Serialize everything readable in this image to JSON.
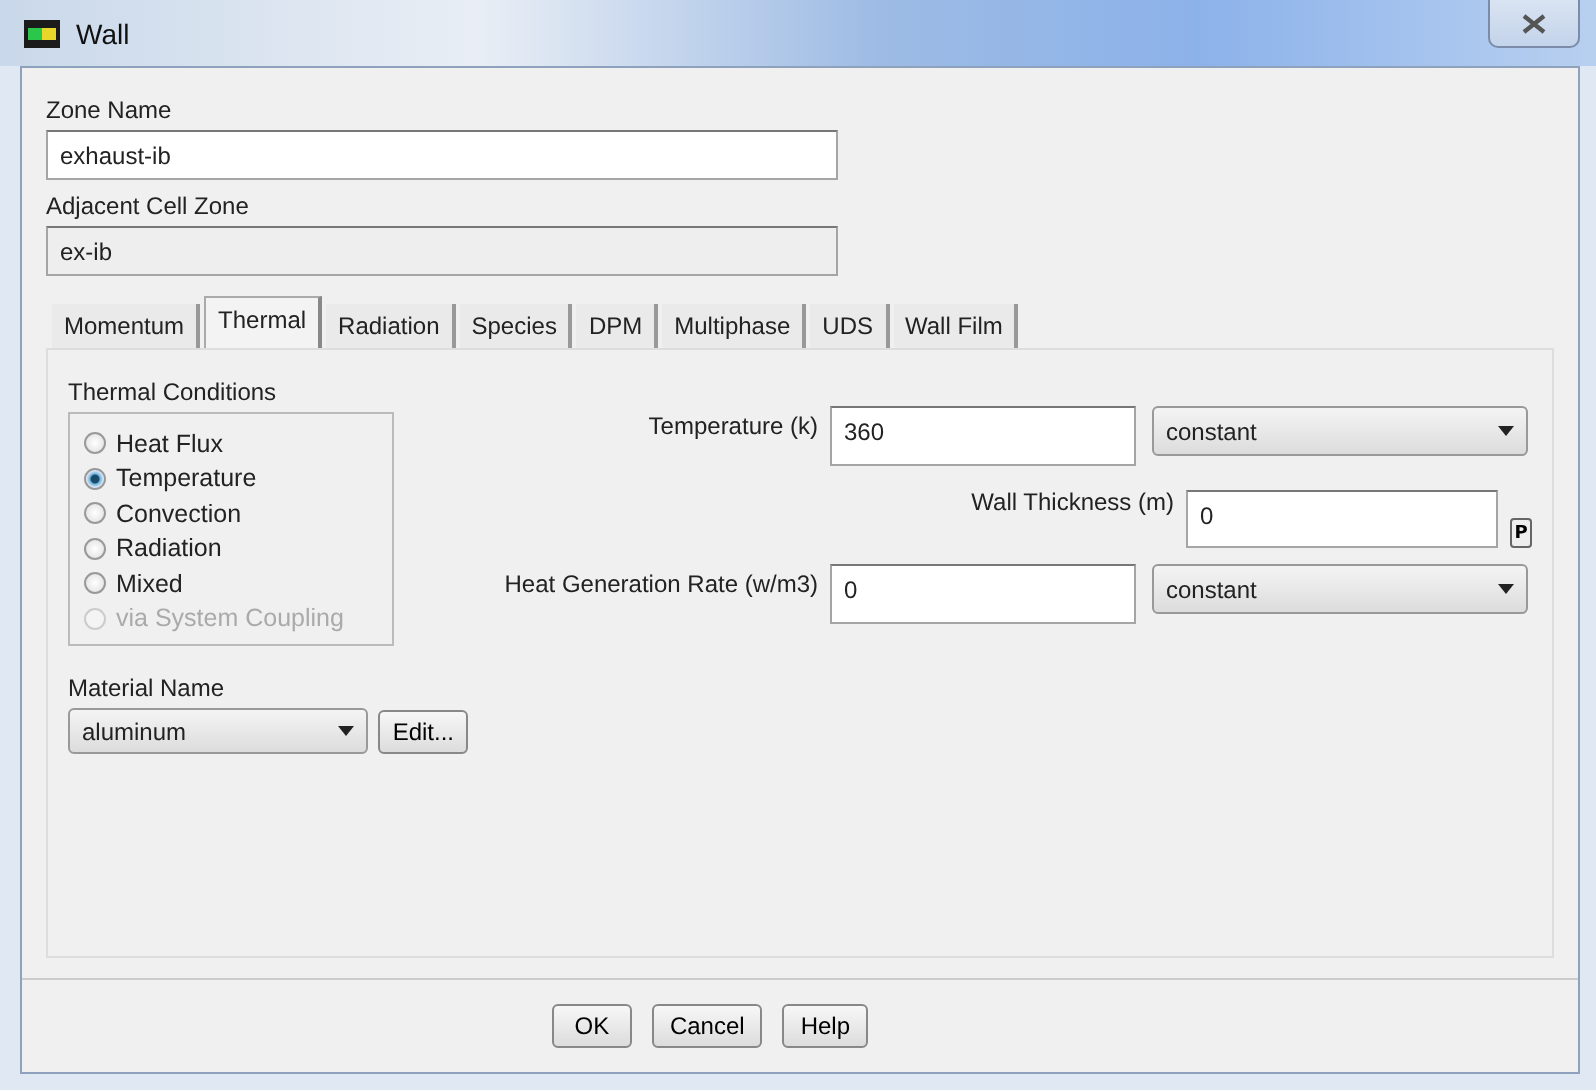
{
  "window": {
    "title": "Wall"
  },
  "zone_name": {
    "label": "Zone Name",
    "value": "exhaust-ib"
  },
  "adjacent_cell_zone": {
    "label": "Adjacent Cell Zone",
    "value": "ex-ib"
  },
  "tabs": [
    {
      "label": "Momentum",
      "selected": false
    },
    {
      "label": "Thermal",
      "selected": true
    },
    {
      "label": "Radiation",
      "selected": false
    },
    {
      "label": "Species",
      "selected": false
    },
    {
      "label": "DPM",
      "selected": false
    },
    {
      "label": "Multiphase",
      "selected": false
    },
    {
      "label": "UDS",
      "selected": false
    },
    {
      "label": "Wall Film",
      "selected": false
    }
  ],
  "thermal_conditions": {
    "title": "Thermal Conditions",
    "options": [
      {
        "label": "Heat Flux",
        "selected": false,
        "disabled": false
      },
      {
        "label": "Temperature",
        "selected": true,
        "disabled": false
      },
      {
        "label": "Convection",
        "selected": false,
        "disabled": false
      },
      {
        "label": "Radiation",
        "selected": false,
        "disabled": false
      },
      {
        "label": "Mixed",
        "selected": false,
        "disabled": false
      },
      {
        "label": "via System Coupling",
        "selected": false,
        "disabled": true
      }
    ]
  },
  "material": {
    "label": "Material Name",
    "value": "aluminum",
    "edit_button": "Edit..."
  },
  "fields": [
    {
      "kind": "profile",
      "label": "Temperature (k)",
      "value": "360",
      "method": "constant"
    },
    {
      "kind": "parameter",
      "label": "Wall Thickness (m)",
      "value": "0",
      "parameter_button": "P"
    },
    {
      "kind": "profile",
      "label": "Heat Generation Rate (w/m3)",
      "value": "0",
      "method": "constant"
    }
  ],
  "buttons": [
    "OK",
    "Cancel",
    "Help"
  ]
}
